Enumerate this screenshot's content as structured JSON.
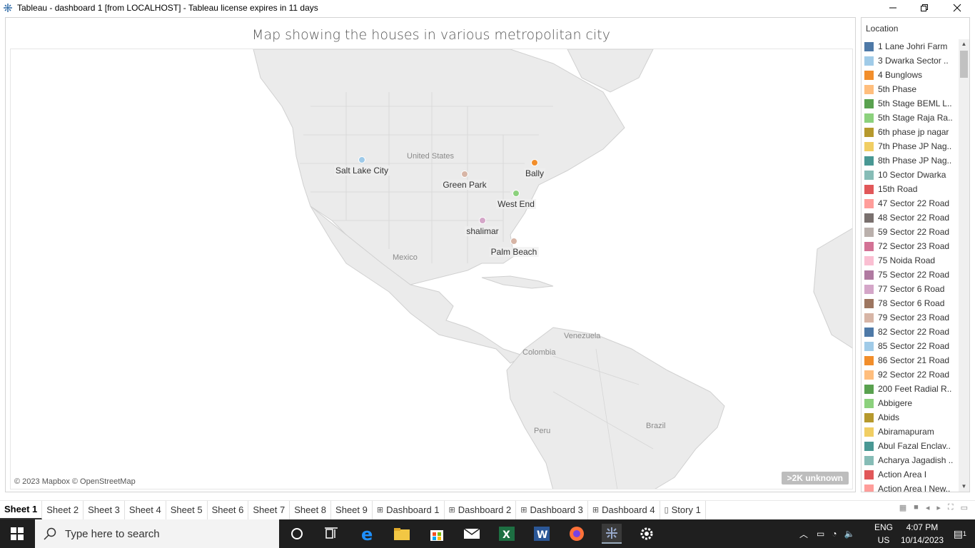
{
  "window": {
    "title": "Tableau - dashboard 1 [from LOCALHOST] - Tableau license expires in 11 days"
  },
  "viz": {
    "title": "Map showing the houses in various metropolitan city",
    "copyright": "© 2023 Mapbox © OpenStreetMap",
    "unknown_badge": ">2K unknown",
    "region_labels": {
      "united_states": "United States",
      "mexico": "Mexico",
      "venezuela": "Venezuela",
      "colombia": "Colombia",
      "peru": "Peru",
      "brazil": "Brazil"
    },
    "cities": [
      {
        "name": "Salt Lake City",
        "color": "#9ecae9"
      },
      {
        "name": "Green Park",
        "color": "#d7b5a6"
      },
      {
        "name": "Bally",
        "color": "#f28e2b"
      },
      {
        "name": "West End",
        "color": "#8cd17d"
      },
      {
        "name": "shalimar",
        "color": "#d4a6c8"
      },
      {
        "name": "Palm Beach",
        "color": "#d7b5a6"
      }
    ]
  },
  "legend": {
    "title": "Location",
    "items": [
      {
        "label": "1 Lane Johri Farm",
        "color": "#4e79a7"
      },
      {
        "label": "3 Dwarka Sector ..",
        "color": "#a0cbe8"
      },
      {
        "label": "4 Bunglows",
        "color": "#f28e2b"
      },
      {
        "label": "5th Phase",
        "color": "#ffbe7d"
      },
      {
        "label": "5th Stage BEML L..",
        "color": "#59a14f"
      },
      {
        "label": "5th Stage Raja Ra..",
        "color": "#8cd17d"
      },
      {
        "label": "6th phase jp nagar",
        "color": "#b6992d"
      },
      {
        "label": "7th Phase JP Nag..",
        "color": "#f1ce63"
      },
      {
        "label": "8th Phase JP Nag..",
        "color": "#499894"
      },
      {
        "label": "10 Sector Dwarka",
        "color": "#86bcb6"
      },
      {
        "label": "15th Road",
        "color": "#e15759"
      },
      {
        "label": "47 Sector 22 Road",
        "color": "#ff9d9a"
      },
      {
        "label": "48 Sector 22 Road",
        "color": "#79706e"
      },
      {
        "label": "59 Sector 22 Road",
        "color": "#bab0ac"
      },
      {
        "label": "72 Sector 23 Road",
        "color": "#d37295"
      },
      {
        "label": "75 Noida Road",
        "color": "#fabfd2"
      },
      {
        "label": "75 Sector 22 Road",
        "color": "#b07aa1"
      },
      {
        "label": "77 Sector 6 Road",
        "color": "#d4a6c8"
      },
      {
        "label": "78 Sector 6 Road",
        "color": "#9d7660"
      },
      {
        "label": "79 Sector 23 Road",
        "color": "#d7b5a6"
      },
      {
        "label": "82 Sector 22 Road",
        "color": "#4e79a7"
      },
      {
        "label": "85 Sector 22 Road",
        "color": "#a0cbe8"
      },
      {
        "label": "86 Sector 21 Road",
        "color": "#f28e2b"
      },
      {
        "label": "92 Sector 22 Road",
        "color": "#ffbe7d"
      },
      {
        "label": "200 Feet Radial R..",
        "color": "#59a14f"
      },
      {
        "label": "Abbigere",
        "color": "#8cd17d"
      },
      {
        "label": "Abids",
        "color": "#b6992d"
      },
      {
        "label": "Abiramapuram",
        "color": "#f1ce63"
      },
      {
        "label": "Abul Fazal Enclav..",
        "color": "#499894"
      },
      {
        "label": "Acharya Jagadish ..",
        "color": "#86bcb6"
      },
      {
        "label": "Action Area I",
        "color": "#e15759"
      },
      {
        "label": "Action Area I New..",
        "color": "#ff9d9a"
      }
    ]
  },
  "tabs": [
    {
      "label": "Sheet 1",
      "type": "sheet"
    },
    {
      "label": "Sheet 2",
      "type": "sheet"
    },
    {
      "label": "Sheet 3",
      "type": "sheet"
    },
    {
      "label": "Sheet 4",
      "type": "sheet"
    },
    {
      "label": "Sheet 5",
      "type": "sheet"
    },
    {
      "label": "Sheet 6",
      "type": "sheet"
    },
    {
      "label": "Sheet 7",
      "type": "sheet"
    },
    {
      "label": "Sheet 8",
      "type": "sheet"
    },
    {
      "label": "Sheet 9",
      "type": "sheet"
    },
    {
      "label": "Dashboard 1",
      "type": "dashboard"
    },
    {
      "label": "Dashboard 2",
      "type": "dashboard"
    },
    {
      "label": "Dashboard 3",
      "type": "dashboard"
    },
    {
      "label": "Dashboard 4",
      "type": "dashboard"
    },
    {
      "label": "Story 1",
      "type": "story"
    }
  ],
  "taskbar": {
    "search_placeholder": "Type here to search",
    "lang_top": "ENG",
    "lang_bottom": "US",
    "time": "4:07 PM",
    "date": "10/14/2023",
    "notif_count": "1"
  }
}
